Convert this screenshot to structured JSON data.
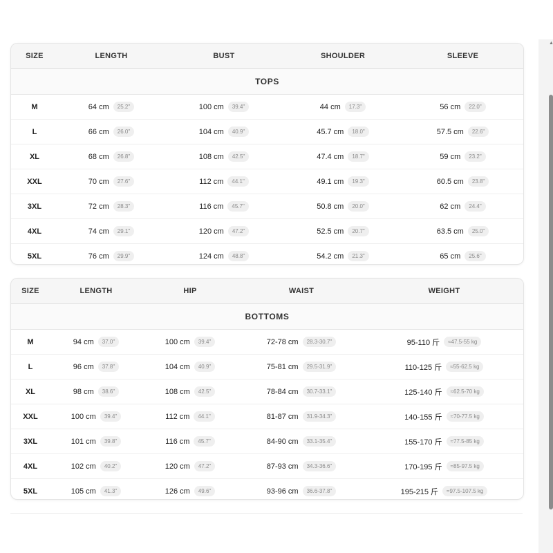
{
  "tops": {
    "headers": [
      "SIZE",
      "LENGTH",
      "BUST",
      "SHOULDER",
      "SLEEVE"
    ],
    "section_title": "TOPS",
    "rows": [
      {
        "size": "M",
        "cells": [
          [
            "64 cm",
            "25.2\""
          ],
          [
            "100 cm",
            "39.4\""
          ],
          [
            "44 cm",
            "17.3\""
          ],
          [
            "56 cm",
            "22.0\""
          ]
        ]
      },
      {
        "size": "L",
        "cells": [
          [
            "66 cm",
            "26.0\""
          ],
          [
            "104 cm",
            "40.9\""
          ],
          [
            "45.7 cm",
            "18.0\""
          ],
          [
            "57.5 cm",
            "22.6\""
          ]
        ]
      },
      {
        "size": "XL",
        "cells": [
          [
            "68 cm",
            "26.8\""
          ],
          [
            "108 cm",
            "42.5\""
          ],
          [
            "47.4 cm",
            "18.7\""
          ],
          [
            "59 cm",
            "23.2\""
          ]
        ]
      },
      {
        "size": "XXL",
        "cells": [
          [
            "70 cm",
            "27.6\""
          ],
          [
            "112 cm",
            "44.1\""
          ],
          [
            "49.1 cm",
            "19.3\""
          ],
          [
            "60.5 cm",
            "23.8\""
          ]
        ]
      },
      {
        "size": "3XL",
        "cells": [
          [
            "72 cm",
            "28.3\""
          ],
          [
            "116 cm",
            "45.7\""
          ],
          [
            "50.8 cm",
            "20.0\""
          ],
          [
            "62 cm",
            "24.4\""
          ]
        ]
      },
      {
        "size": "4XL",
        "cells": [
          [
            "74 cm",
            "29.1\""
          ],
          [
            "120 cm",
            "47.2\""
          ],
          [
            "52.5 cm",
            "20.7\""
          ],
          [
            "63.5 cm",
            "25.0\""
          ]
        ]
      },
      {
        "size": "5XL",
        "cells": [
          [
            "76 cm",
            "29.9\""
          ],
          [
            "124 cm",
            "48.8\""
          ],
          [
            "54.2 cm",
            "21.3\""
          ],
          [
            "65 cm",
            "25.6\""
          ]
        ]
      }
    ]
  },
  "bottoms": {
    "headers": [
      "SIZE",
      "LENGTH",
      "HIP",
      "WAIST",
      "WEIGHT"
    ],
    "section_title": "BOTTOMS",
    "rows": [
      {
        "size": "M",
        "cells": [
          [
            "94 cm",
            "37.0\""
          ],
          [
            "100 cm",
            "39.4\""
          ],
          [
            "72-78 cm",
            "28.3-30.7\""
          ],
          [
            "95-110 斤",
            "≈47.5-55 kg"
          ]
        ]
      },
      {
        "size": "L",
        "cells": [
          [
            "96 cm",
            "37.8\""
          ],
          [
            "104 cm",
            "40.9\""
          ],
          [
            "75-81 cm",
            "29.5-31.9\""
          ],
          [
            "110-125 斤",
            "≈55-62.5 kg"
          ]
        ]
      },
      {
        "size": "XL",
        "cells": [
          [
            "98 cm",
            "38.6\""
          ],
          [
            "108 cm",
            "42.5\""
          ],
          [
            "78-84 cm",
            "30.7-33.1\""
          ],
          [
            "125-140 斤",
            "≈62.5-70 kg"
          ]
        ]
      },
      {
        "size": "XXL",
        "cells": [
          [
            "100 cm",
            "39.4\""
          ],
          [
            "112 cm",
            "44.1\""
          ],
          [
            "81-87 cm",
            "31.9-34.3\""
          ],
          [
            "140-155 斤",
            "≈70-77.5 kg"
          ]
        ]
      },
      {
        "size": "3XL",
        "cells": [
          [
            "101 cm",
            "39.8\""
          ],
          [
            "116 cm",
            "45.7\""
          ],
          [
            "84-90 cm",
            "33.1-35.4\""
          ],
          [
            "155-170 斤",
            "≈77.5-85 kg"
          ]
        ]
      },
      {
        "size": "4XL",
        "cells": [
          [
            "102 cm",
            "40.2\""
          ],
          [
            "120 cm",
            "47.2\""
          ],
          [
            "87-93 cm",
            "34.3-36.6\""
          ],
          [
            "170-195 斤",
            "≈85-97.5 kg"
          ]
        ]
      },
      {
        "size": "5XL",
        "cells": [
          [
            "105 cm",
            "41.3\""
          ],
          [
            "126 cm",
            "49.6\""
          ],
          [
            "93-96 cm",
            "36.6-37.8\""
          ],
          [
            "195-215 斤",
            "≈97.5-107.5 kg"
          ]
        ]
      }
    ]
  }
}
